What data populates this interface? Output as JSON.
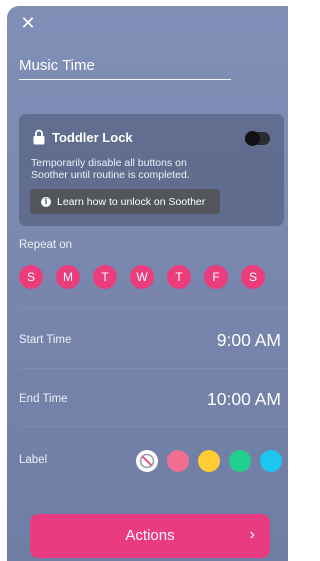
{
  "header": {
    "close_glyph": "✕",
    "routine_name": "Music Time"
  },
  "toddler_lock": {
    "title": "Toddler Lock",
    "description": "Temporarily disable all buttons on Soother until routine is completed.",
    "enabled": false,
    "learn_button_label": "Learn how to unlock on Soother",
    "info_glyph": "i"
  },
  "repeat": {
    "label": "Repeat on",
    "days": [
      "S",
      "M",
      "T",
      "W",
      "T",
      "F",
      "S"
    ]
  },
  "start_time": {
    "label": "Start Time",
    "value": "9:00 AM"
  },
  "end_time": {
    "label": "End Time",
    "value": "10:00 AM"
  },
  "label_colors": {
    "label": "Label",
    "options": [
      "none",
      "#ef6d8f",
      "#ffcc33",
      "#1fd18d",
      "#1cc6ef"
    ]
  },
  "actions": {
    "label": "Actions",
    "chevron": "›"
  },
  "colors": {
    "accent": "#e83b80",
    "day_fill": "#eb3d7c",
    "sheet_bg": "#7b8ab1"
  }
}
